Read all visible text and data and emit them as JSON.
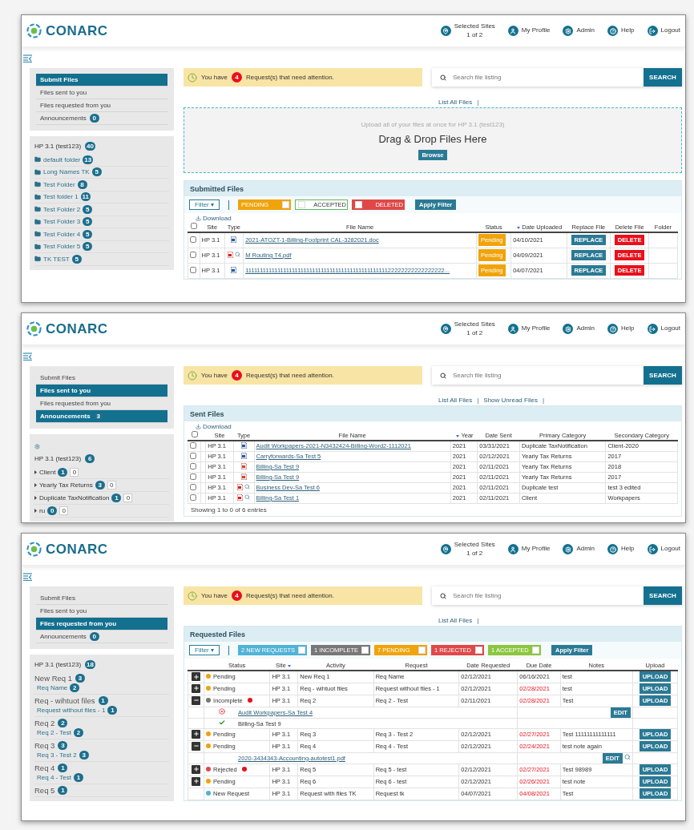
{
  "panels": [
    {
      "header": {
        "logo": "CONARC",
        "nav": [
          {
            "kind": "sites",
            "label": "Selected Sites",
            "sub": "1 of 2"
          },
          {
            "kind": "profile",
            "label": "My Profile"
          },
          {
            "kind": "admin",
            "label": "Admin"
          },
          {
            "kind": "help",
            "label": "Help"
          },
          {
            "kind": "logout",
            "label": "Logout"
          }
        ]
      },
      "sidebar": {
        "nav": [
          {
            "label": "Submit Files",
            "selected": true
          },
          {
            "label": "Files sent to you",
            "selected": false
          },
          {
            "label": "Files requested from you",
            "selected": false
          },
          {
            "label": "Announcements",
            "badge": "0",
            "selected": false
          }
        ],
        "site": {
          "kind": "folders",
          "title": "HP 3.1 (test123)",
          "badge": "40",
          "items": [
            {
              "name": "default folder",
              "badge": "13"
            },
            {
              "name": "Long Names TK",
              "badge": "5"
            },
            {
              "name": "Test Folder",
              "badge": "8"
            },
            {
              "name": "Test folder 1",
              "badge": "11"
            },
            {
              "name": "Test Folder 2",
              "badge": "5"
            },
            {
              "name": "Test Folder 3",
              "badge": "5"
            },
            {
              "name": "Test Folder 4",
              "badge": "5"
            },
            {
              "name": "Test Folder 5",
              "badge": "5"
            },
            {
              "name": "TK TEST",
              "badge": "5"
            }
          ]
        }
      },
      "alert": {
        "before": "You have",
        "count": "4",
        "after": "Request(s) that need attention."
      },
      "search": {
        "placeholder": "Search file listing",
        "button": "SEARCH",
        "separator": "|",
        "links": [
          "List All Files"
        ]
      },
      "main": {
        "kind": "upload",
        "dropzone": {
          "hint": "Upload all of your files at once for HP 3.1 (test123)",
          "title": "Drag & Drop Files Here",
          "button": "Browse"
        },
        "title": "Submitted Files",
        "filter": "Filter ▾",
        "apply": "Apply Filter",
        "download": "Download",
        "all_checked": false,
        "chips": [
          {
            "label": "PENDING",
            "color": "#f0a30a",
            "outline": false,
            "checked": true
          },
          {
            "label": "ACCEPTED",
            "color": "#5cb85c",
            "outline": true,
            "checked": false
          },
          {
            "label": "DELETED",
            "color": "#e04848",
            "outline": false,
            "checked": false
          }
        ],
        "columns": [
          {
            "label": "Site",
            "sorted": false
          },
          {
            "label": "Type",
            "sorted": false
          },
          {
            "label": "File Name",
            "sorted": false
          },
          {
            "label": "Status",
            "sorted": false
          },
          {
            "label": "Date Uploaded",
            "sorted": true
          },
          {
            "label": "Replace File",
            "sorted": false
          },
          {
            "label": "Delete File",
            "sorted": false
          },
          {
            "label": "Folder",
            "sorted": false
          }
        ],
        "rows": [
          {
            "checked": false,
            "site": "HP 3.1",
            "kind": "word",
            "preview": false,
            "name": "2021-ATOZT-1-Billing-Footprint CAL-3282021.doc",
            "status": "Pending",
            "date": "04/10/2021",
            "replace": "REPLACE",
            "delete": "DELETE"
          },
          {
            "checked": false,
            "site": "HP 3.1",
            "kind": "pdf",
            "preview": true,
            "name": "M Routing T4.pdf",
            "status": "Pending",
            "date": "04/09/2021",
            "replace": "REPLACE",
            "delete": "DELETE"
          },
          {
            "checked": false,
            "site": "HP 3.1",
            "kind": "word",
            "preview": false,
            "name": "111111111111111111111111111111111111111111111111122222222222222222...",
            "status": "Pending",
            "date": "04/07/2021",
            "replace": "REPLACE",
            "delete": "DELETE"
          }
        ]
      }
    },
    {
      "header": {
        "logo": "CONARC",
        "nav": [
          {
            "kind": "sites",
            "label": "Selected Sites",
            "sub": "1 of 2"
          },
          {
            "kind": "profile",
            "label": "My Profile"
          },
          {
            "kind": "admin",
            "label": "Admin"
          },
          {
            "kind": "help",
            "label": "Help"
          },
          {
            "kind": "logout",
            "label": "Logout"
          }
        ]
      },
      "sidebar": {
        "nav": [
          {
            "label": "Submit Files",
            "selected": false
          },
          {
            "label": "Files sent to you",
            "selected": true
          },
          {
            "label": "Files requested from you",
            "selected": false
          },
          {
            "label": "Announcements",
            "badge": "3",
            "selected": true
          }
        ],
        "site": {
          "kind": "tree",
          "title": "HP 3.1 (test123)",
          "badge": "6",
          "items": [
            {
              "name": "Client",
              "badge": "1",
              "extra": "0"
            },
            {
              "name": "Yearly Tax Returns",
              "badge": "3",
              "extra": "0"
            },
            {
              "name": "Duplicate TaxNotification",
              "badge": "1",
              "extra": "0"
            },
            {
              "name": "ru",
              "badge": "0",
              "extra": "0"
            }
          ]
        }
      },
      "alert": {
        "before": "You have",
        "count": "4",
        "after": "Request(s) that need attention."
      },
      "search": {
        "placeholder": "Search file listing",
        "button": "SEARCH",
        "separator": "|",
        "links": [
          "List All Files",
          "Show Unread Files"
        ]
      },
      "main": {
        "kind": "sent",
        "title": "Sent Files",
        "download": "Download",
        "all_checked": false,
        "columns": [
          {
            "label": "Site",
            "sorted": false
          },
          {
            "label": "Type",
            "sorted": false
          },
          {
            "label": "File Name",
            "sorted": false
          },
          {
            "label": "Year",
            "sorted": true
          },
          {
            "label": "Date Sent",
            "sorted": false
          },
          {
            "label": "Primary Category",
            "sorted": false
          },
          {
            "label": "Secondary Category",
            "sorted": false
          }
        ],
        "rows": [
          {
            "checked": false,
            "site": "HP 3.1",
            "kind": "word",
            "preview": false,
            "name": "Audit Workpapers-2021-N3432424-Billing-Word2-1112021",
            "year": "2021",
            "date": "03/31/2021",
            "primary": "Duplicate TaxNotification",
            "secondary": "Client-2020"
          },
          {
            "checked": false,
            "site": "HP 3.1",
            "kind": "word",
            "preview": false,
            "name": "Carryforwards-Sa Test 5",
            "year": "2021",
            "date": "02/12/2021",
            "primary": "Yearly Tax Returns",
            "secondary": "2017"
          },
          {
            "checked": false,
            "site": "HP 3.1",
            "kind": "ppt",
            "preview": false,
            "name": "Billing-Sa Test 9",
            "year": "2021",
            "date": "02/11/2021",
            "primary": "Yearly Tax Returns",
            "secondary": "2018"
          },
          {
            "checked": false,
            "site": "HP 3.1",
            "kind": "ppt",
            "preview": false,
            "name": "Billing-Sa Test 9",
            "year": "2021",
            "date": "02/11/2021",
            "primary": "Yearly Tax Returns",
            "secondary": "2017"
          },
          {
            "checked": false,
            "site": "HP 3.1",
            "kind": "pdf",
            "preview": true,
            "name": "Business Dev-Sa Test 6",
            "year": "2021",
            "date": "02/11/2021",
            "primary": "Duplicate test",
            "secondary": "test 3 edited"
          },
          {
            "checked": false,
            "site": "HP 3.1",
            "kind": "pdf",
            "preview": true,
            "name": "Billing-Sa Test 1",
            "year": "2021",
            "date": "02/11/2021",
            "primary": "Client",
            "secondary": "Workpapers"
          }
        ],
        "footer": "Showing 1 to 0 of 6 entries"
      }
    },
    {
      "header": {
        "logo": "CONARC",
        "nav": [
          {
            "kind": "sites",
            "label": "Selected Sites",
            "sub": "1 of 2"
          },
          {
            "kind": "profile",
            "label": "My Profile"
          },
          {
            "kind": "admin",
            "label": "Admin"
          },
          {
            "kind": "help",
            "label": "Help"
          },
          {
            "kind": "logout",
            "label": "Logout"
          }
        ]
      },
      "sidebar": {
        "nav": [
          {
            "label": "Submit Files",
            "selected": false
          },
          {
            "label": "Files sent to you",
            "selected": false
          },
          {
            "label": "Files requested from you",
            "selected": true
          },
          {
            "label": "Announcements",
            "badge": "0",
            "selected": false
          }
        ],
        "site": {
          "kind": "requests",
          "title": "HP 3.1 (test123)",
          "badge": "18",
          "items": [
            {
              "name": "New Req 1",
              "badge": "3",
              "children": [
                {
                  "name": "Req Name",
                  "badge": "2"
                }
              ]
            },
            {
              "name": "Req - wihtuot files",
              "badge": "1",
              "children": [
                {
                  "name": "Request without files - 1",
                  "badge": "1"
                }
              ]
            },
            {
              "name": "Req 2",
              "badge": "2",
              "children": [
                {
                  "name": "Req 2 - Test",
                  "badge": "2"
                }
              ]
            },
            {
              "name": "Req 3",
              "badge": "3",
              "children": [
                {
                  "name": "Req 3 - Test 2",
                  "badge": "3"
                }
              ]
            },
            {
              "name": "Req 4",
              "badge": "1",
              "children": [
                {
                  "name": "Req 4 - Test",
                  "badge": "1"
                }
              ]
            },
            {
              "name": "Req 5",
              "badge": "1"
            }
          ]
        }
      },
      "alert": {
        "before": "You have",
        "count": "4",
        "after": "Request(s) that need attention."
      },
      "search": {
        "placeholder": "Search file listing",
        "button": "SEARCH",
        "separator": "|",
        "links": [
          "List All Files"
        ]
      },
      "main": {
        "kind": "requested",
        "title": "Requested Files",
        "filter": "Filter ▾",
        "apply": "Apply Filter",
        "chips": [
          {
            "label": "2 NEW REQUESTS",
            "color": "#4fb3d6",
            "outline": false,
            "checked": true
          },
          {
            "label": "1 INCOMPLETE",
            "color": "#777777",
            "outline": false,
            "checked": true
          },
          {
            "label": "7 PENDING",
            "color": "#f0a30a",
            "outline": false,
            "checked": true
          },
          {
            "label": "1 REJECTED",
            "color": "#e04848",
            "outline": false,
            "checked": true
          },
          {
            "label": "1 ACCEPTED",
            "color": "#8cc63f",
            "outline": false,
            "checked": true
          }
        ],
        "columns": [
          {
            "label": "Status",
            "sorted": false
          },
          {
            "label": "Site",
            "sorted": true
          },
          {
            "label": "Activity",
            "sorted": false
          },
          {
            "label": "Request",
            "sorted": false
          },
          {
            "label": "Date Requested",
            "sorted": false
          },
          {
            "label": "Due Date",
            "sorted": false
          },
          {
            "label": "Notes",
            "sorted": false
          },
          {
            "label": "Upload",
            "sorted": false
          }
        ],
        "rows": [
          {
            "kind": "request",
            "toggle": true,
            "expanded": false,
            "status": "Pending",
            "color": "#f0a30a",
            "flag": false,
            "site": "HP 3.1",
            "activity": "New Req 1",
            "request": "Req Name",
            "requested": "02/12/2021",
            "due": "06/16/2021",
            "overdue": false,
            "notes": "test",
            "upload": "UPLOAD"
          },
          {
            "kind": "request",
            "toggle": true,
            "expanded": false,
            "status": "Pending",
            "color": "#f0a30a",
            "flag": false,
            "site": "HP 3.1",
            "activity": "Req - wihtuot files",
            "request": "Request without files - 1",
            "requested": "02/12/2021",
            "due": "02/28/2021",
            "overdue": true,
            "notes": "test",
            "upload": "UPLOAD"
          },
          {
            "kind": "request",
            "toggle": true,
            "expanded": true,
            "status": "Incomplete",
            "color": "#777777",
            "flag": true,
            "site": "HP 3.1",
            "activity": "Req 2",
            "request": "Req 2 - Test",
            "requested": "02/11/2021",
            "due": "02/28/2021",
            "overdue": true,
            "notes": "Test",
            "upload": "UPLOAD"
          },
          {
            "kind": "file",
            "accepted": false,
            "link": true,
            "name": "Audit Workpapers-Sa Test 4",
            "edit": "EDIT",
            "preview": false
          },
          {
            "kind": "file",
            "accepted": true,
            "link": false,
            "name": "Billing-Sa Test 9",
            "preview": false
          },
          {
            "kind": "request",
            "toggle": true,
            "expanded": false,
            "status": "Pending",
            "color": "#f0a30a",
            "flag": false,
            "site": "HP 3.1",
            "activity": "Req 3",
            "request": "Req 3 - Test 2",
            "requested": "02/12/2021",
            "due": "02/27/2021",
            "overdue": true,
            "notes": "Test 11111111111111",
            "upload": "UPLOAD"
          },
          {
            "kind": "request",
            "toggle": true,
            "expanded": true,
            "status": "Pending",
            "color": "#f0a30a",
            "flag": false,
            "site": "HP 3.1",
            "activity": "Req 4",
            "request": "Req 4 - Test",
            "requested": "02/12/2021",
            "due": "02/24/2021",
            "overdue": true,
            "notes": "test note again",
            "upload": "UPLOAD"
          },
          {
            "kind": "file",
            "link": true,
            "name": "2020-3434343-Accounting-autotest1.pdf",
            "edit": "EDIT",
            "preview": true
          },
          {
            "kind": "request",
            "toggle": true,
            "expanded": false,
            "status": "Rejected",
            "color": "#e04848",
            "flag": true,
            "site": "HP 3.1",
            "activity": "Req 5",
            "request": "Req 5 - test",
            "requested": "02/12/2021",
            "due": "02/27/2021",
            "overdue": true,
            "notes": "Test 98989",
            "upload": "UPLOAD"
          },
          {
            "kind": "request",
            "toggle": true,
            "expanded": false,
            "status": "Pending",
            "color": "#f0a30a",
            "flag": false,
            "site": "HP 3.1",
            "activity": "Req 6",
            "request": "Req 6 - test",
            "requested": "02/12/2021",
            "due": "02/26/2021",
            "overdue": true,
            "notes": "test note",
            "upload": "UPLOAD"
          },
          {
            "kind": "request",
            "toggle": false,
            "status": "New Request",
            "color": "#4fb3d6",
            "flag": false,
            "site": "HP 3.1",
            "activity": "Request with files TK",
            "request": "Request tk",
            "requested": "04/07/2021",
            "due": "04/08/2021",
            "overdue": true,
            "notes": "Test",
            "upload": "UPLOAD"
          }
        ]
      }
    }
  ]
}
